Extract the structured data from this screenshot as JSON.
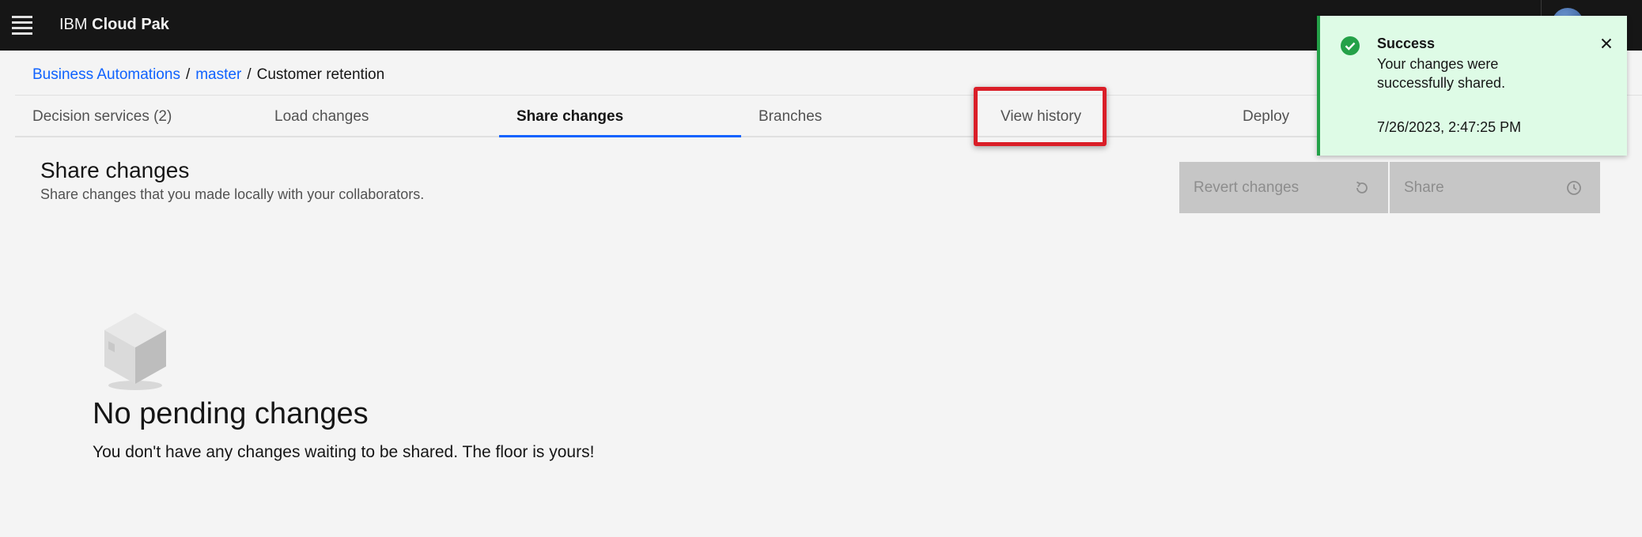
{
  "header": {
    "brand_prefix": "IBM",
    "brand_product": "Cloud Pak"
  },
  "breadcrumb": {
    "items": [
      "Business Automations",
      "master"
    ],
    "separator": "/",
    "current": "Customer retention"
  },
  "tabs": [
    {
      "label": "Decision services (2)",
      "active": false
    },
    {
      "label": "Load changes",
      "active": false
    },
    {
      "label": "Share changes",
      "active": true
    },
    {
      "label": "Branches",
      "active": false
    },
    {
      "label": "View history",
      "active": false,
      "highlighted": true
    },
    {
      "label": "Deploy",
      "active": false
    }
  ],
  "section": {
    "title": "Share changes",
    "subtitle": "Share changes that you made locally with your collaborators."
  },
  "actions": {
    "revert_label": "Revert changes",
    "revert_icon": "reset-icon",
    "share_label": "Share",
    "share_icon": "clock-icon",
    "disabled": true
  },
  "empty_state": {
    "icon": "box-icon",
    "title": "No pending changes",
    "description": "You don't have any changes waiting to be shared. The floor is yours!"
  },
  "toast": {
    "kind": "success",
    "title": "Success",
    "message": "Your changes were successfully shared.",
    "timestamp": "7/26/2023, 2:47:25 PM",
    "accent_color": "#24a148",
    "background_color": "#defbe6"
  },
  "colors": {
    "link": "#0f62fe",
    "active_tab_indicator": "#0f62fe",
    "highlight": "#da1e28",
    "topbar": "#161616"
  }
}
